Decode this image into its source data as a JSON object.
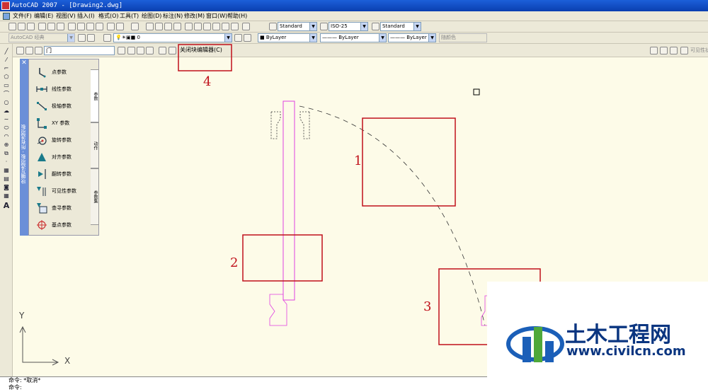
{
  "window": {
    "title": "AutoCAD 2007 - [Drawing2.dwg]"
  },
  "menu": [
    "文件(F)",
    "编辑(E)",
    "视图(V)",
    "插入(I)",
    "格式(O)",
    "工具(T)",
    "绘图(D)",
    "标注(N)",
    "修改(M)",
    "窗口(W)",
    "帮助(H)"
  ],
  "toolbar": {
    "text_style": "Standard",
    "dim_style": "ISO-25",
    "table_style": "Standard",
    "workspace": "AutoCAD 经典",
    "layer": "0",
    "color": "ByLayer",
    "linetype": "ByLayer",
    "lineweight": "ByLayer",
    "plotstyle": "随颜色"
  },
  "block_editor": {
    "block_name": "门",
    "close_label": "关闭块编辑器(C)",
    "visibility_label": "可见性状"
  },
  "palette": {
    "title": "块编写选项板 - 所有选项板",
    "items": [
      "点参数",
      "线性参数",
      "极轴参数",
      "XY 参数",
      "旋转参数",
      "对齐参数",
      "翻转参数",
      "可见性参数",
      "查寻参数",
      "基点参数"
    ],
    "tabs": [
      "参数",
      "动作",
      "参数集"
    ]
  },
  "annotations": [
    "1",
    "2",
    "3",
    "4"
  ],
  "ucs": {
    "x": "X",
    "y": "Y"
  },
  "command": {
    "line1": "命令: *取消*",
    "line2": "命令:"
  },
  "watermark": {
    "cn": "土木工程网",
    "url": "www.civilcn.com"
  },
  "colors": {
    "canvas": "#fdfbe8",
    "annotation": "#c0101a",
    "block": "#e040e0",
    "title": "#0a3fb0"
  }
}
